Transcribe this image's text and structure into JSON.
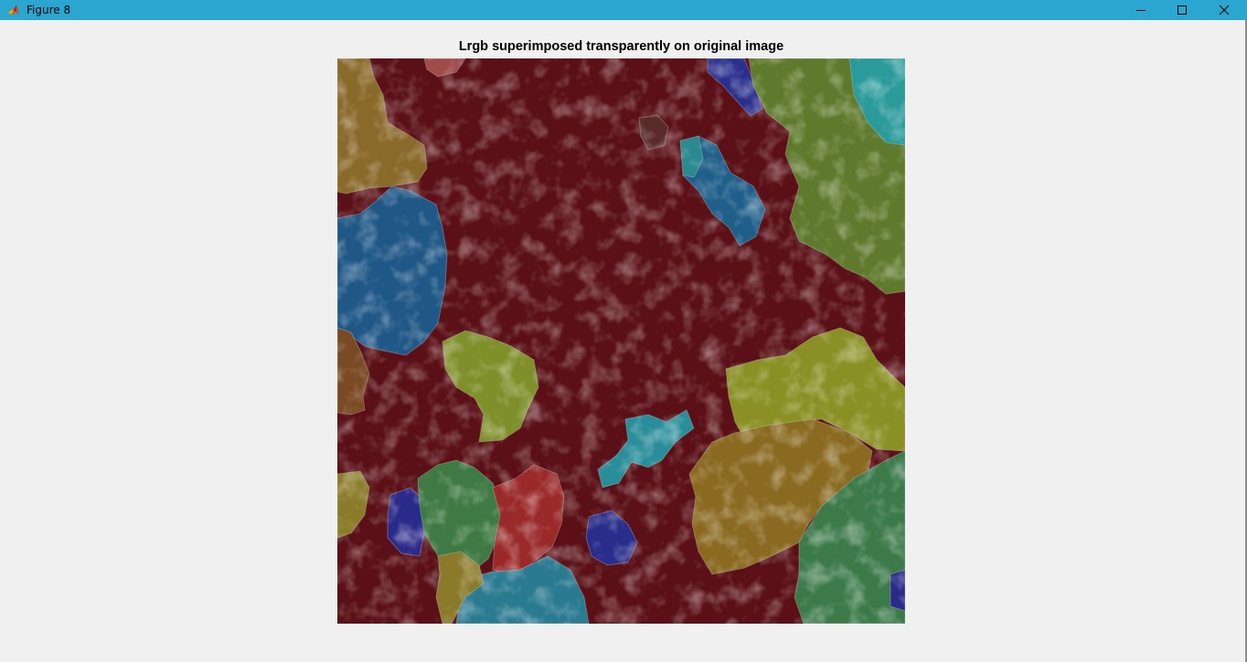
{
  "window": {
    "title": "Figure 8",
    "title_bar_color": "#2ba6d1",
    "icon": "matlab-icon",
    "controls": {
      "minimize": "minimize-icon",
      "maximize": "maximize-icon",
      "close": "close-icon"
    }
  },
  "figure": {
    "title": "Lrgb superimposed transparently on original image",
    "background_color": "#5a1016",
    "region_colors": [
      "#8c7a2c",
      "#1e5a8c",
      "#5e7a2c",
      "#2c8c8c",
      "#1e2a8c",
      "#3c7a4a",
      "#8c2a2a",
      "#7a5a1e"
    ]
  }
}
